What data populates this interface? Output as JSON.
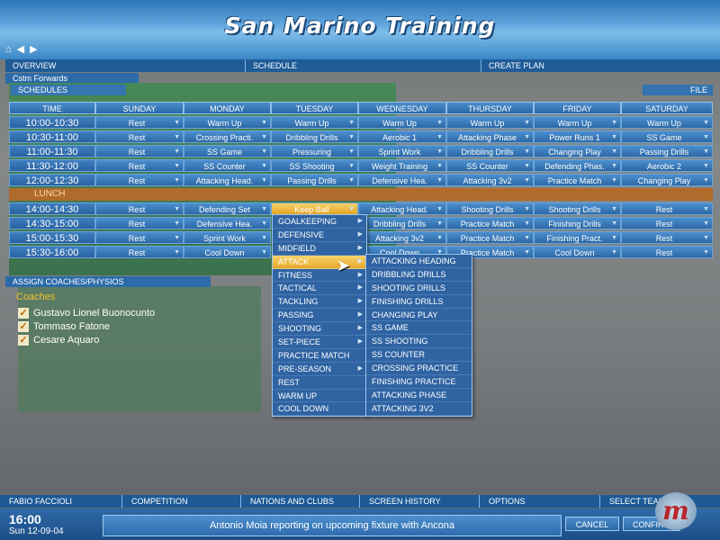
{
  "window_title": "San Marino Training",
  "nav_icons": [
    "home-icon",
    "back-arrow-icon",
    "forward-arrow-icon"
  ],
  "top_tabs": [
    "OVERVIEW",
    "SCHEDULE",
    "CREATE PLAN"
  ],
  "sub_tab": "Cstm Forwards",
  "schedules_label": "SCHEDULES",
  "file_label": "FILE",
  "grid": {
    "time_header": "TIME",
    "days": [
      "SUNDAY",
      "MONDAY",
      "TUESDAY",
      "WEDNESDAY",
      "THURSDAY",
      "FRIDAY",
      "SATURDAY"
    ],
    "rows_am": [
      {
        "time": "10:00-10:30",
        "cells": [
          "Rest",
          "Warm Up",
          "Warm Up",
          "Warm Up",
          "Warm Up",
          "Warm Up",
          "Warm Up"
        ]
      },
      {
        "time": "10:30-11:00",
        "cells": [
          "Rest",
          "Crossing Practi.",
          "Dribbling Drills",
          "Aerobic 1",
          "Attacking Phase",
          "Power Runs 1",
          "SS Game"
        ]
      },
      {
        "time": "11:00-11:30",
        "cells": [
          "Rest",
          "SS Game",
          "Pressuring",
          "Sprint Work",
          "Dribbling Drills",
          "Changing Play",
          "Passing Drills"
        ]
      },
      {
        "time": "11:30-12:00",
        "cells": [
          "Rest",
          "SS Counter",
          "SS Shooting",
          "Weight Training",
          "SS Counter",
          "Defending Phas.",
          "Aerobic 2"
        ]
      },
      {
        "time": "12:00-12:30",
        "cells": [
          "Rest",
          "Attacking Head.",
          "Passing Drills",
          "Defensive Hea.",
          "Attacking 3v2",
          "Practice Match",
          "Changing Play"
        ]
      }
    ],
    "lunch_label": "LUNCH",
    "rows_pm": [
      {
        "time": "14:00-14:30",
        "cells": [
          "Rest",
          "Defending Set",
          "Keep Ball",
          "Attacking Head.",
          "Shooting Drills",
          "Shooting Drills",
          "Rest"
        ]
      },
      {
        "time": "14:30-15:00",
        "cells": [
          "Rest",
          "Defensive Hea.",
          "",
          "Dribbling Drills",
          "Practice Match",
          "Finishing Drills",
          "Rest"
        ]
      },
      {
        "time": "15:00-15:30",
        "cells": [
          "Rest",
          "Sprint Work",
          "",
          "Attacking 3v2",
          "Practice Match",
          "Finishing Pract.",
          "Rest"
        ]
      },
      {
        "time": "15:30-16:00",
        "cells": [
          "Rest",
          "Cool Down",
          "",
          "Cool Down",
          "Practice Match",
          "Cool Down",
          "Rest"
        ]
      }
    ]
  },
  "category_menu": [
    "GOALKEEPING",
    "DEFENSIVE",
    "MIDFIELD",
    "ATTACK",
    "FITNESS",
    "TACTICAL",
    "TACKLING",
    "PASSING",
    "SHOOTING",
    "SET-PIECE",
    "PRACTICE MATCH",
    "PRE-SEASON",
    "REST",
    "WARM UP",
    "COOL DOWN"
  ],
  "category_submenu_flags": [
    true,
    true,
    true,
    true,
    true,
    true,
    true,
    true,
    true,
    true,
    false,
    true,
    false,
    false,
    false
  ],
  "selected_category": "ATTACK",
  "attack_submenu": [
    "ATTACKING HEADING",
    "DRIBBLING DRILLS",
    "SHOOTING DRILLS",
    "FINISHING DRILLS",
    "CHANGING PLAY",
    "SS GAME",
    "SS SHOOTING",
    "SS COUNTER",
    "CROSSING PRACTICE",
    "FINISHING PRACTICE",
    "ATTACKING PHASE",
    "ATTACKING 3V2"
  ],
  "assign_label": "ASSIGN COACHES/PHYSIOS",
  "coaches_title": "Coaches",
  "coaches": [
    "Gustavo Lionel Buonocunto",
    "Tommaso Fatone",
    "Cesare Aquaro"
  ],
  "bottom_tabs": [
    "FABIO FACCIOLI",
    "COMPETITION",
    "NATIONS AND CLUBS",
    "SCREEN HISTORY",
    "OPTIONS",
    "SELECT TEAM"
  ],
  "clock": "16:00",
  "date": "Sun 12-09-04",
  "news": "Antonio Moia reporting on upcoming fixture with Ancona",
  "cancel_label": "CANCEL",
  "confirm_label": "CONFIRM",
  "logo_letter": "m",
  "colors": {
    "accent": "#2b68a6",
    "highlight": "#e9a72a",
    "lunch": "#b06a2b",
    "coaches_title": "#f2c12e"
  }
}
